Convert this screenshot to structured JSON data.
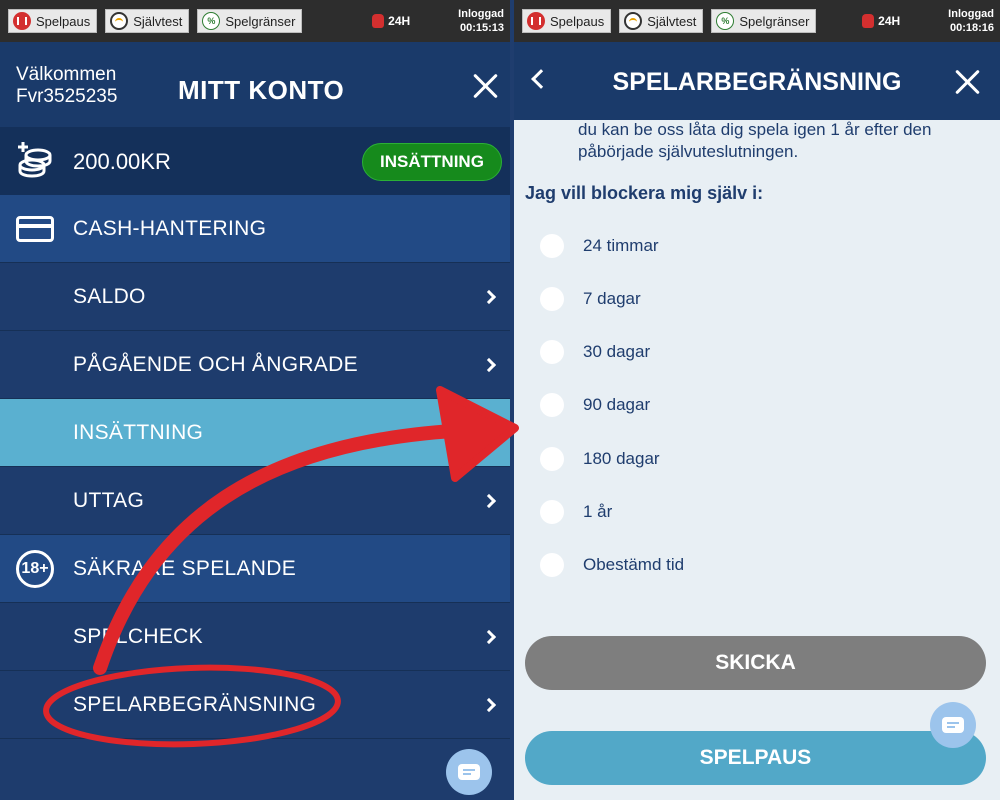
{
  "topbar_left": {
    "spelpaus": "Spelpaus",
    "sjalvtest": "Självtest",
    "spelgranser": "Spelgränser",
    "limit": "24H",
    "status_label": "Inloggad",
    "timer": "00:15:13"
  },
  "topbar_right": {
    "spelpaus": "Spelpaus",
    "sjalvtest": "Självtest",
    "spelgranser": "Spelgränser",
    "limit": "24H",
    "status_label": "Inloggad",
    "timer": "00:18:16"
  },
  "account": {
    "welcome": "Välkommen",
    "username": "Fvr3525235",
    "title": "MITT KONTO",
    "balance": "200.00KR",
    "deposit_button": "INSÄTTNING"
  },
  "menu": {
    "cash_section": "CASH-HANTERING",
    "items_cash": [
      {
        "label": "SALDO"
      },
      {
        "label": "PÅGÅENDE OCH ÅNGRADE"
      },
      {
        "label": "INSÄTTNING"
      },
      {
        "label": "UTTAG"
      }
    ],
    "safe_section": "SÄKRARE SPELANDE",
    "safe_badge": "18+",
    "items_safe": [
      {
        "label": "SPELCHECK"
      },
      {
        "label": "SPELARBEGRÄNSNING"
      }
    ]
  },
  "limits_panel": {
    "title": "SPELARBEGRÄNSNING",
    "info_text": "du kan be oss låta dig spela igen 1 år efter den påbörjade självuteslutningen.",
    "question": "Jag vill blockera mig själv i:",
    "options": [
      {
        "label": "24 timmar"
      },
      {
        "label": "7 dagar"
      },
      {
        "label": "30 dagar"
      },
      {
        "label": "90 dagar"
      },
      {
        "label": "180 dagar"
      },
      {
        "label": "1 år"
      },
      {
        "label": "Obestämd tid"
      }
    ],
    "send_button": "SKICKA",
    "pause_button": "SPELPAUS"
  },
  "colors": {
    "nav_dark": "#1a3a6a",
    "section_blue": "#224a85",
    "active_item": "#5ab0d0",
    "deposit_green": "#168a1c",
    "annotation_red": "#e0262a"
  },
  "icons": [
    "pause-icon",
    "selftest-gauge-icon",
    "limits-icon",
    "stop-hand-icon",
    "close-icon",
    "coins-icon",
    "card-icon",
    "age-18-icon",
    "chevron-right-icon",
    "back-chevron-icon",
    "chat-icon"
  ]
}
